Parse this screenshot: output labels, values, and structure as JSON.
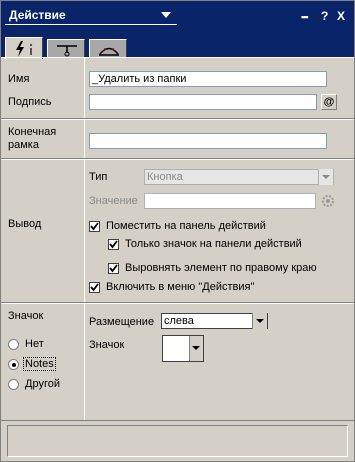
{
  "window": {
    "title": "Действие",
    "buttons": {
      "menu": "▪▪▪",
      "help": "?",
      "close": "X"
    }
  },
  "tabs": [
    {
      "icon": "lightning-info-icon",
      "active": true
    },
    {
      "icon": "hide-when-icon",
      "active": false
    },
    {
      "icon": "paragraph-hide-icon",
      "active": false
    }
  ],
  "fields": {
    "name_label": "Имя",
    "name_value": "_Удалить из папки",
    "label_label": "Подпись",
    "label_value": "",
    "label_button": "@",
    "target_frame_label": "Конечная рамка",
    "target_frame_value": ""
  },
  "output": {
    "section_label": "Вывод",
    "type_label": "Тип",
    "type_value": "Кнопка",
    "value_label": "Значение",
    "value_value": "",
    "checkboxes": [
      {
        "label": "Поместить на панель действий",
        "checked": true
      },
      {
        "label": "Только значок на панели действий",
        "checked": true
      },
      {
        "label": "Выровнять элемент по правому краю",
        "checked": true
      },
      {
        "label": "Включить в меню \"Действия\"",
        "checked": true
      }
    ]
  },
  "icon_section": {
    "section_label": "Значок",
    "radios": [
      {
        "label": "Нет",
        "selected": false
      },
      {
        "label": "Notes",
        "selected": true
      },
      {
        "label": "Другой",
        "selected": false
      }
    ],
    "placement_label": "Размещение",
    "placement_value": "слева",
    "icon_label": "Значок",
    "icon_value": ""
  },
  "colors": {
    "titlebar": "#0a246a",
    "panel": "#d4d0c8",
    "field_border": "#7f9db9"
  }
}
